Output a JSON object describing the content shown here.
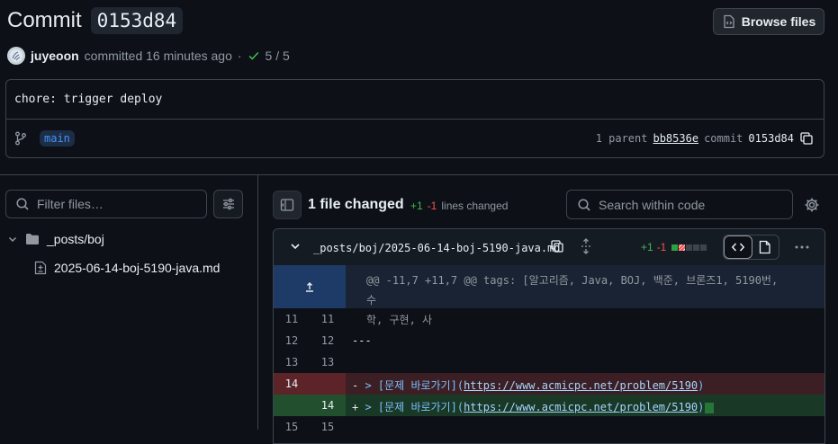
{
  "header": {
    "title": "Commit",
    "hash": "0153d84",
    "browse_label": "Browse files"
  },
  "meta": {
    "user": "juyeoon",
    "action": "committed 16 minutes ago",
    "separator": "·",
    "checks": "5 / 5"
  },
  "commit": {
    "message": "chore: trigger deploy",
    "branch": "main",
    "parent_label": "1 parent",
    "parent_sha": "bb8536e",
    "commit_label": "commit",
    "commit_sha": "0153d84"
  },
  "sidebar": {
    "filter_placeholder": "Filter files…",
    "folder": "_posts/boj",
    "file": "2025-06-14-boj-5190-java.md"
  },
  "summary": {
    "changed": "1 file changed",
    "additions": "+1",
    "deletions": "-1",
    "lines_label": "lines changed",
    "search_placeholder": "Search within code"
  },
  "diff": {
    "path": "_posts/boj/2025-06-14-boj-5190-java.md",
    "additions": "+1",
    "deletions": "-1",
    "block_colors": [
      "#2ea043",
      "#f85149",
      "#3d444d",
      "#3d444d",
      "#3d444d"
    ],
    "hunk_line1": "@@ -11,7 +11,7 @@ tags: [알고리즘, Java, BOJ, 백준, 브론즈1, 5190번, 수",
    "hunk_line2": "학, 구현, 사",
    "rows": {
      "r11": {
        "old": "11",
        "new": "11",
        "code": ""
      },
      "r12": {
        "old": "12",
        "new": "12",
        "code": "---"
      },
      "r13": {
        "old": "13",
        "new": "13",
        "code": ""
      },
      "del": {
        "old": "14",
        "new": "",
        "sign": "-",
        "prefix": " > [문제 바로가기](",
        "url": "https://www.acmicpc.net/problem/5190",
        "suffix": ")"
      },
      "add": {
        "old": "",
        "new": "14",
        "sign": "+",
        "prefix": " > [문제 바로가기](",
        "url": "https://www.acmicpc.net/problem/5190",
        "suffix": ")"
      },
      "r15": {
        "old": "15",
        "new": "15",
        "code": ""
      }
    }
  }
}
